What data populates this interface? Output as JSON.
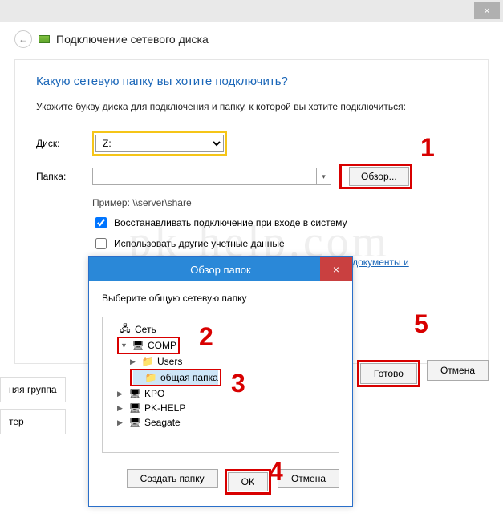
{
  "outer": {
    "close_glyph": "×"
  },
  "wizard": {
    "title": "Подключение сетевого диска",
    "back_glyph": "←",
    "question": "Какую сетевую папку вы хотите подключить?",
    "instruction": "Укажите букву диска для подключения и папку, к которой вы хотите подключиться:",
    "drive_label": "Диск:",
    "drive_value": "Z:",
    "folder_label": "Папка:",
    "folder_value": "",
    "browse_label": "Обзор...",
    "example": "Пример: \\\\server\\share",
    "reconnect_label": "Восстанавливать подключение при входе в систему",
    "reconnect_checked": true,
    "other_creds_label": "Использовать другие учетные данные",
    "other_creds_checked": false,
    "link_text": "Подключение к веб-сайту, на котором вы можете хранить документы и изображения",
    "done_label": "Готово",
    "cancel_label": "Отмена"
  },
  "browse_dialog": {
    "title": "Обзор папок",
    "close_glyph": "×",
    "instruction": "Выберите общую сетевую папку",
    "tree": [
      {
        "level": 0,
        "icon": "net",
        "expand": "",
        "label": "Сеть"
      },
      {
        "level": 1,
        "icon": "pc",
        "expand": "▼",
        "label": "COMP",
        "red_box": true
      },
      {
        "level": 2,
        "icon": "folder",
        "expand": "▶",
        "label": "Users"
      },
      {
        "level": 2,
        "icon": "folder",
        "expand": "",
        "label": "общая папка",
        "selected": true,
        "red_box": true
      },
      {
        "level": 1,
        "icon": "pc",
        "expand": "▶",
        "label": "KPO"
      },
      {
        "level": 1,
        "icon": "pc",
        "expand": "▶",
        "label": "PK-HELP"
      },
      {
        "level": 1,
        "icon": "pc",
        "expand": "▶",
        "label": "Seagate"
      }
    ],
    "new_folder_label": "Создать папку",
    "ok_label": "ОК",
    "cancel_label": "Отмена"
  },
  "explorer": {
    "homegroup": "няя группа",
    "computer": "тер"
  },
  "annotations": {
    "n1": "1",
    "n2": "2",
    "n3": "3",
    "n4": "4",
    "n5": "5"
  },
  "watermark": "pk-help.com"
}
